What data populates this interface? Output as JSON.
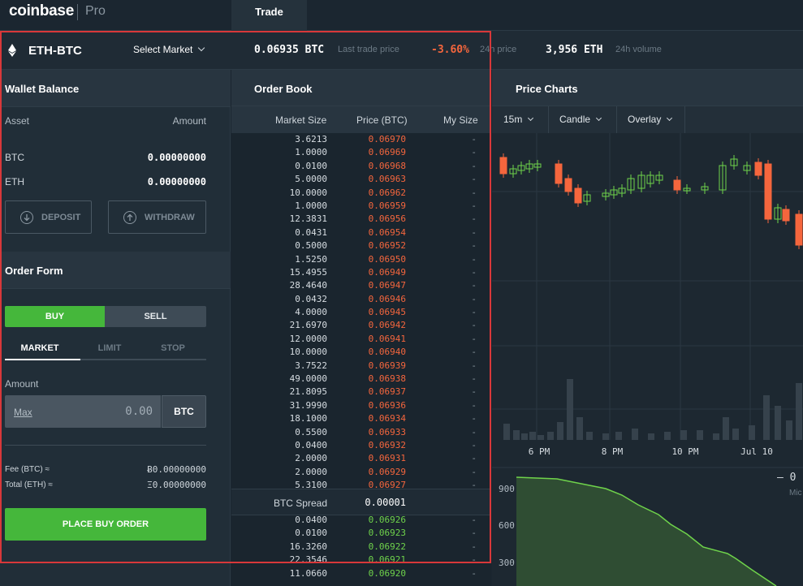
{
  "header": {
    "logo": "coinbase",
    "logo_suffix": "Pro",
    "tab": "Trade"
  },
  "market": {
    "pair": "ETH-BTC",
    "select_label": "Select Market",
    "last_price": "0.06935 BTC",
    "last_price_label": "Last trade price",
    "change": "-3.60%",
    "change_label": "24h price",
    "volume": "3,956 ETH",
    "volume_label": "24h volume"
  },
  "wallet": {
    "title": "Wallet Balance",
    "col_asset": "Asset",
    "col_amount": "Amount",
    "assets": [
      {
        "name": "BTC",
        "amount": "0.00000000"
      },
      {
        "name": "ETH",
        "amount": "0.00000000"
      }
    ],
    "deposit": "DEPOSIT",
    "withdraw": "WITHDRAW"
  },
  "order_form": {
    "title": "Order Form",
    "buy": "BUY",
    "sell": "SELL",
    "tabs": [
      "MARKET",
      "LIMIT",
      "STOP"
    ],
    "amount_label": "Amount",
    "max": "Max",
    "amount_value": "0.00",
    "unit": "BTC",
    "fee_label": "Fee (BTC) ≈",
    "fee_value": "Ƀ0.00000000",
    "total_label": "Total (ETH) ≈",
    "total_value": "Ξ0.00000000",
    "place": "PLACE BUY ORDER"
  },
  "order_book": {
    "title": "Order Book",
    "col_size": "Market Size",
    "col_price": "Price (BTC)",
    "col_my": "My Size",
    "asks": [
      {
        "size": "3.6213",
        "price": "0.06970",
        "my": "-"
      },
      {
        "size": "1.0000",
        "price": "0.06969",
        "my": "-"
      },
      {
        "size": "0.0100",
        "price": "0.06968",
        "my": "-"
      },
      {
        "size": "5.0000",
        "price": "0.06963",
        "my": "-"
      },
      {
        "size": "10.0000",
        "price": "0.06962",
        "my": "-"
      },
      {
        "size": "1.0000",
        "price": "0.06959",
        "my": "-"
      },
      {
        "size": "12.3831",
        "price": "0.06956",
        "my": "-"
      },
      {
        "size": "0.0431",
        "price": "0.06954",
        "my": "-"
      },
      {
        "size": "0.5000",
        "price": "0.06952",
        "my": "-"
      },
      {
        "size": "1.5250",
        "price": "0.06950",
        "my": "-"
      },
      {
        "size": "15.4955",
        "price": "0.06949",
        "my": "-"
      },
      {
        "size": "28.4640",
        "price": "0.06947",
        "my": "-"
      },
      {
        "size": "0.0432",
        "price": "0.06946",
        "my": "-"
      },
      {
        "size": "4.0000",
        "price": "0.06945",
        "my": "-"
      },
      {
        "size": "21.6970",
        "price": "0.06942",
        "my": "-"
      },
      {
        "size": "12.0000",
        "price": "0.06941",
        "my": "-"
      },
      {
        "size": "10.0000",
        "price": "0.06940",
        "my": "-"
      },
      {
        "size": "3.7522",
        "price": "0.06939",
        "my": "-"
      },
      {
        "size": "49.0000",
        "price": "0.06938",
        "my": "-"
      },
      {
        "size": "21.8095",
        "price": "0.06937",
        "my": "-"
      },
      {
        "size": "31.9990",
        "price": "0.06936",
        "my": "-"
      },
      {
        "size": "18.1000",
        "price": "0.06934",
        "my": "-"
      },
      {
        "size": "0.5500",
        "price": "0.06933",
        "my": "-"
      },
      {
        "size": "0.0400",
        "price": "0.06932",
        "my": "-"
      },
      {
        "size": "2.0000",
        "price": "0.06931",
        "my": "-"
      },
      {
        "size": "2.0000",
        "price": "0.06929",
        "my": "-"
      },
      {
        "size": "5.3100",
        "price": "0.06927",
        "my": "-"
      }
    ],
    "spread_label": "BTC Spread",
    "spread_value": "0.00001",
    "bids": [
      {
        "size": "0.0400",
        "price": "0.06926",
        "my": "-"
      },
      {
        "size": "0.0100",
        "price": "0.06923",
        "my": "-"
      },
      {
        "size": "16.3260",
        "price": "0.06922",
        "my": "-"
      },
      {
        "size": "22.3546",
        "price": "0.06921",
        "my": "-"
      },
      {
        "size": "11.0660",
        "price": "0.06920",
        "my": "-"
      }
    ]
  },
  "price_chart": {
    "title": "Price Charts",
    "interval": "15m",
    "chart_type": "Candle",
    "overlay": "Overlay",
    "x_ticks": [
      "6 PM",
      "8 PM",
      "10 PM",
      "Jul 10"
    ],
    "depth_ticks": [
      "900",
      "600",
      "300"
    ],
    "right_value": "0",
    "right_caption": "Mic",
    "colors": {
      "up": "#6fd34b",
      "down": "#f5663d"
    }
  },
  "chart_data": {
    "type": "line",
    "x": [
      "6 PM",
      "8 PM",
      "10 PM",
      "Jul 10"
    ],
    "series": []
  }
}
